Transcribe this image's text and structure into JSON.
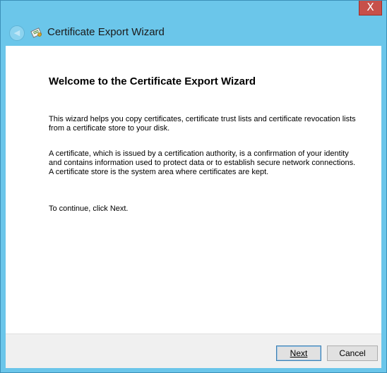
{
  "window": {
    "close_glyph": "X"
  },
  "header": {
    "back_icon": "back-arrow-icon",
    "app_icon": "certificate-icon",
    "title": "Certificate Export Wizard"
  },
  "main": {
    "heading": "Welcome to the Certificate Export Wizard",
    "paragraph_1": "This wizard helps you copy certificates, certificate trust lists and certificate revocation lists from a certificate store to your disk.",
    "paragraph_2": "A certificate, which is issued by a certification authority, is a confirmation of your identity and contains information used to protect data or to establish secure network connections. A certificate store is the system area where certificates are kept.",
    "paragraph_3": "To continue, click Next."
  },
  "footer": {
    "next_label": "Next",
    "cancel_label": "Cancel"
  },
  "colors": {
    "titlebar": "#6bc6ea",
    "close_button": "#c7504a"
  }
}
